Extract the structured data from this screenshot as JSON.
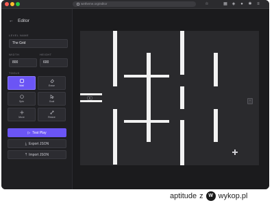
{
  "browser": {
    "url": "wetheme.org/editor",
    "dots": [
      "#ff5f57",
      "#febc2e",
      "#28c840"
    ]
  },
  "sidebar": {
    "back_icon": "arrow-left-icon",
    "title": "Editor",
    "level_name_label": "LEVEL NAME",
    "level_name_value": "The Grid",
    "width_label": "WIDTH",
    "width_value": "800",
    "height_label": "HEIGHT",
    "height_value": "600",
    "tools_label": "TOOLS",
    "tools": [
      {
        "label": "Wall",
        "icon": "square-icon",
        "active": true
      },
      {
        "label": "Erase",
        "icon": "eraser-icon",
        "active": false
      },
      {
        "label": "Spin",
        "icon": "circle-icon",
        "active": false
      },
      {
        "label": "Goal",
        "icon": "pointer-icon",
        "active": false
      },
      {
        "label": "Move",
        "icon": "move-icon",
        "active": false
      },
      {
        "label": "Resize",
        "icon": "resize-icon",
        "active": false
      }
    ],
    "test_play_label": "Test Play",
    "export_label": "Export JSON",
    "import_label": "Import JSON"
  },
  "caption": {
    "user": "aptitude",
    "separator": "z",
    "site": "wykop.pl"
  },
  "colors": {
    "accent": "#6b55f5",
    "panel": "#1f1f22",
    "canvas": "#2a2a2d",
    "wall": "#f2f2f2"
  }
}
